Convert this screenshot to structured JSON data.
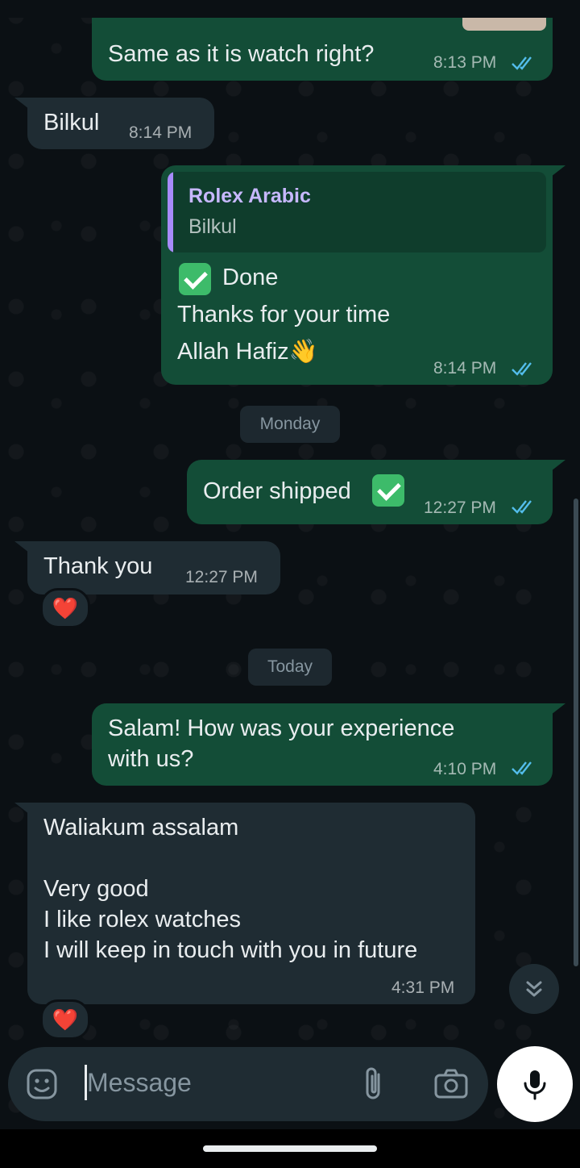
{
  "messages": [
    {
      "text": "Same as it is watch right?",
      "time": "8:13 PM"
    },
    {
      "text": "Bilkul",
      "time": "8:14 PM"
    },
    {
      "quote_name": "Rolex Arabic",
      "quote_text": "Bilkul",
      "line1": "Done",
      "line2": "Thanks for your time",
      "line3": "Allah Hafiz👋",
      "time": "8:14 PM"
    },
    {
      "text": "Order shipped",
      "time": "12:27 PM"
    },
    {
      "text": "Thank you",
      "time": "12:27 PM",
      "reaction": "❤️"
    },
    {
      "line1": "Salam! How was your experience",
      "line2": "with us?",
      "time": "4:10 PM"
    },
    {
      "line1": "Waliakum assalam",
      "line2": "Very good",
      "line3": "I like rolex watches",
      "line4": "I will keep in touch with you in future",
      "time": "4:31 PM",
      "reaction": "❤️"
    }
  ],
  "day_separators": {
    "monday": "Monday",
    "today": "Today"
  },
  "input": {
    "placeholder": "Message"
  },
  "icons": {
    "read_ticks": "double-check-icon",
    "emoji": "sticker-icon",
    "attach": "paperclip-icon",
    "camera": "camera-icon",
    "mic": "mic-icon",
    "scroll_down": "chevrons-down-icon"
  },
  "colors": {
    "outgoing_bubble": "#134d37",
    "incoming_bubble": "#1f2c33",
    "read_tick": "#53bdeb",
    "quote_accent": "#a78bfa"
  }
}
